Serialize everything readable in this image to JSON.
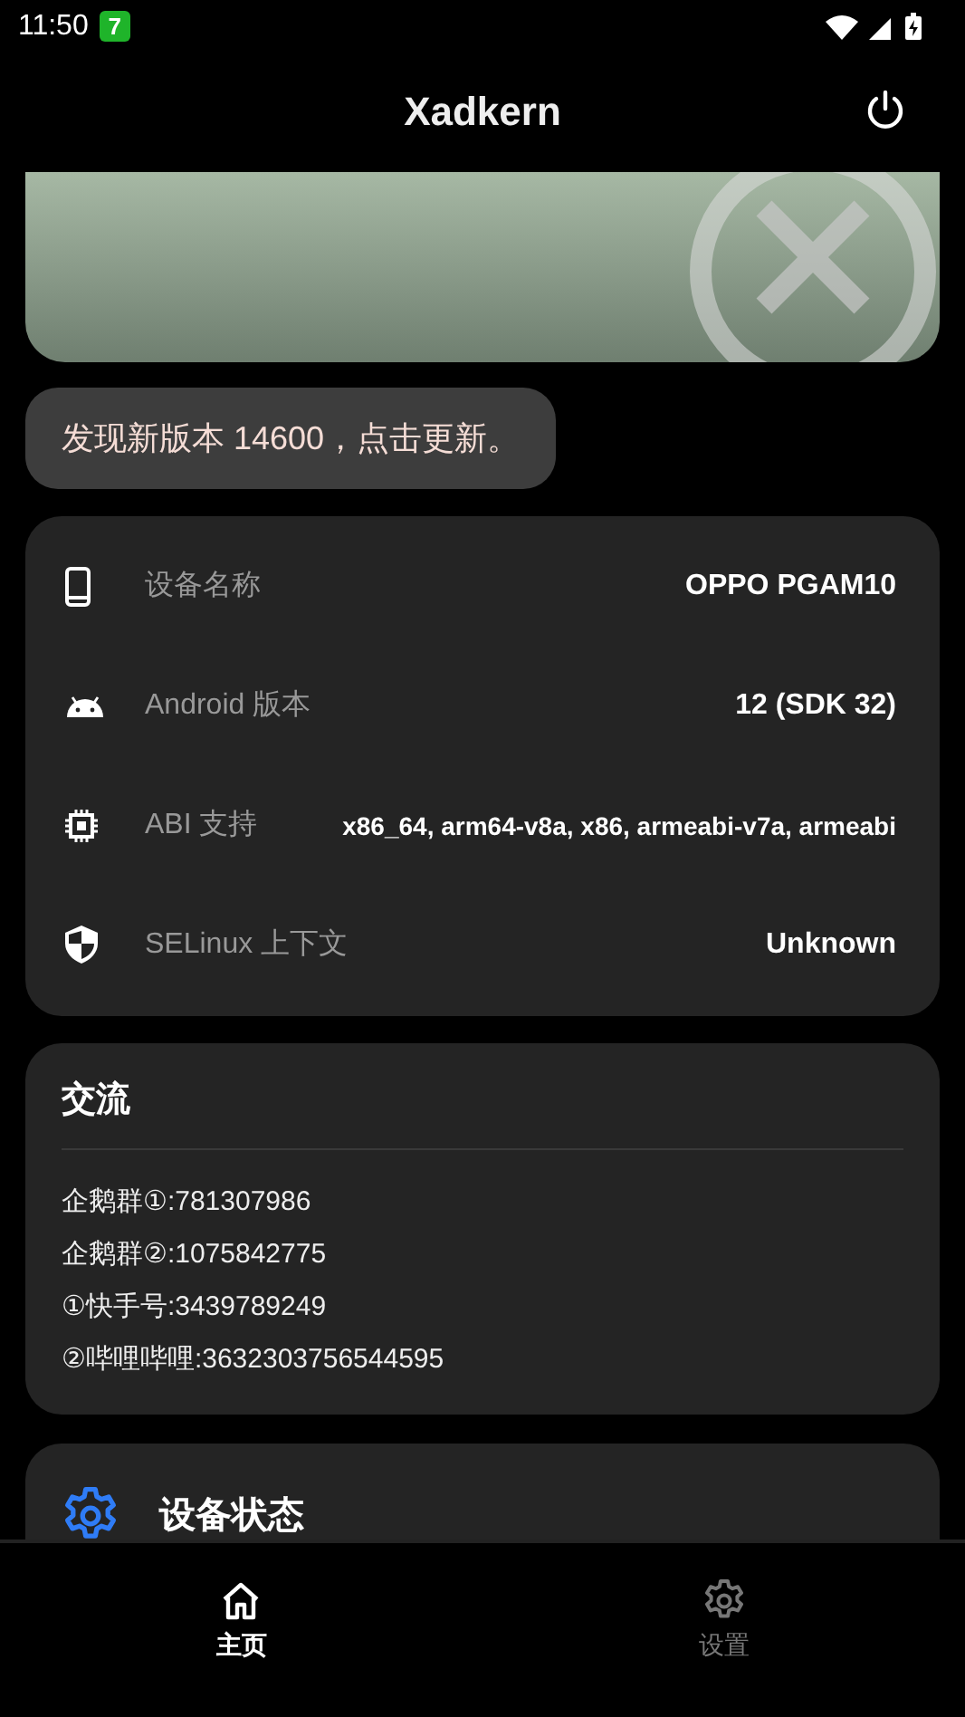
{
  "status_bar": {
    "time": "11:50",
    "badge": "7"
  },
  "app_bar": {
    "title": "Xadkern"
  },
  "update_notice": {
    "text": "发现新版本 14600，点击更新。"
  },
  "device_info": [
    {
      "kind": "phone",
      "label": "设备名称",
      "value": "OPPO PGAM10"
    },
    {
      "kind": "android",
      "label": "Android 版本",
      "value": "12 (SDK 32)"
    },
    {
      "kind": "chip",
      "label": "ABI 支持",
      "value": "x86_64, arm64-v8a, x86, armeabi-v7a, armeabi"
    },
    {
      "kind": "shield",
      "label": "SELinux 上下文",
      "value": "Unknown"
    }
  ],
  "community": {
    "title": "交流",
    "lines": [
      "企鹅群①:781307986",
      "企鹅群②:1075842775",
      "①快手号:3439789249",
      "②哔哩哔哩:3632303756544595"
    ]
  },
  "device_status": {
    "title": "设备状态"
  },
  "bottom_nav": [
    {
      "kind": "home",
      "label": "主页",
      "selected": true
    },
    {
      "kind": "settings",
      "label": "设置",
      "selected": false
    }
  ]
}
